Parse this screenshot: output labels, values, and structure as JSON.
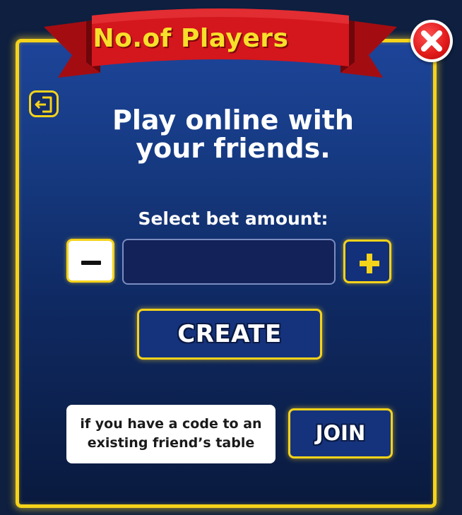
{
  "dialog": {
    "title": "No.of Players",
    "heading": "Play online with\nyour friends.",
    "bet_label": "Select bet amount:",
    "bet_value": "",
    "minus_symbol": "−",
    "plus_symbol": "+",
    "create_label": "CREATE",
    "join_note": "if you have a code to an\nexisting friend’s table",
    "join_label": "JOIN"
  },
  "icons": {
    "close": "close-icon",
    "exit": "exit-icon",
    "minus": "minus-icon",
    "plus": "plus-icon"
  },
  "colors": {
    "accent_gold": "#f5d31a",
    "ribbon_red": "#d4161d",
    "panel_blue": "#1d4499",
    "title_yellow": "#f7e02a"
  }
}
